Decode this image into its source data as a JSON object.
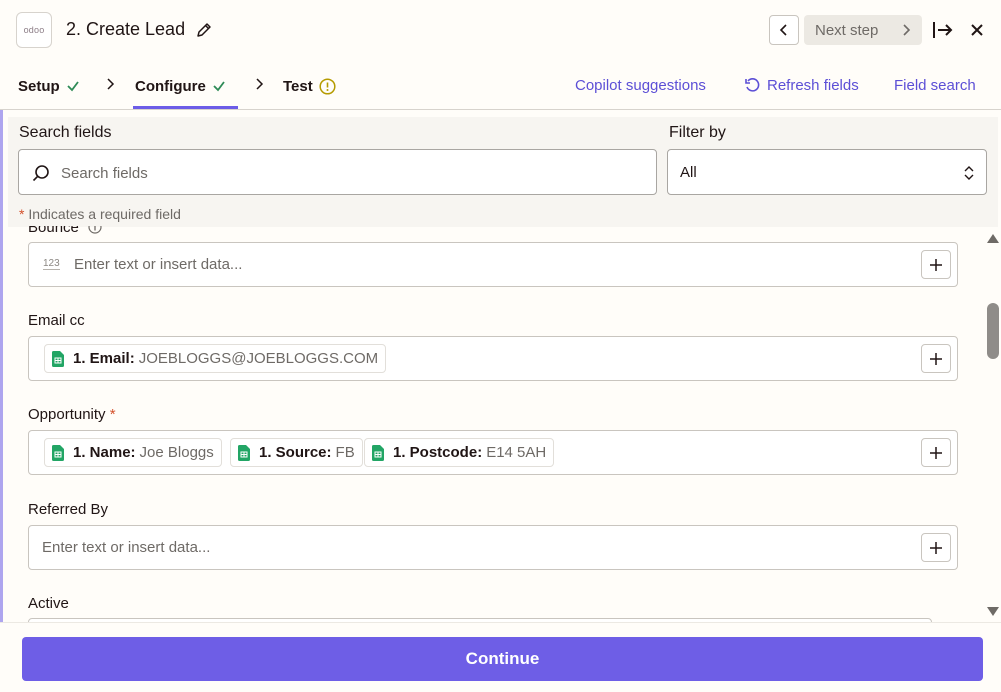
{
  "header": {
    "app_logo_text": "odoo",
    "step_title": "2. Create Lead",
    "next_step_label": "Next step"
  },
  "tabs": [
    {
      "label": "Setup",
      "status": "complete"
    },
    {
      "label": "Configure",
      "status": "complete",
      "active": true
    },
    {
      "label": "Test",
      "status": "warning"
    }
  ],
  "links": {
    "copilot": "Copilot suggestions",
    "refresh": "Refresh fields",
    "field_search": "Field search"
  },
  "search": {
    "label": "Search fields",
    "placeholder": "Search fields",
    "filter_label": "Filter by",
    "filter_value": "All",
    "required_star": "*",
    "required_note": "Indicates a required field"
  },
  "fields": {
    "bounce": {
      "label": "Bounce",
      "type_hint": "123",
      "placeholder": "Enter text or insert data..."
    },
    "email_cc": {
      "label": "Email cc",
      "pills": [
        {
          "key": "1. Email:",
          "value": "JOEBLOGGS@JOEBLOGGS.COM"
        }
      ]
    },
    "opportunity": {
      "label": "Opportunity",
      "required_star": "*",
      "pills": [
        {
          "key": "1. Name:",
          "value": "Joe Bloggs"
        },
        {
          "key": "1. Source:",
          "value": "FB"
        },
        {
          "key": "1. Postcode:",
          "value": "E14 5AH"
        }
      ]
    },
    "referred_by": {
      "label": "Referred By",
      "placeholder": "Enter text or insert data..."
    },
    "active": {
      "label": "Active"
    }
  },
  "footer": {
    "continue_label": "Continue"
  },
  "colors": {
    "accent": "#6c5ce7",
    "check": "#2e8b57",
    "warning": "#b59b00",
    "required": "#d3502b",
    "sheets_green": "#22a565"
  }
}
